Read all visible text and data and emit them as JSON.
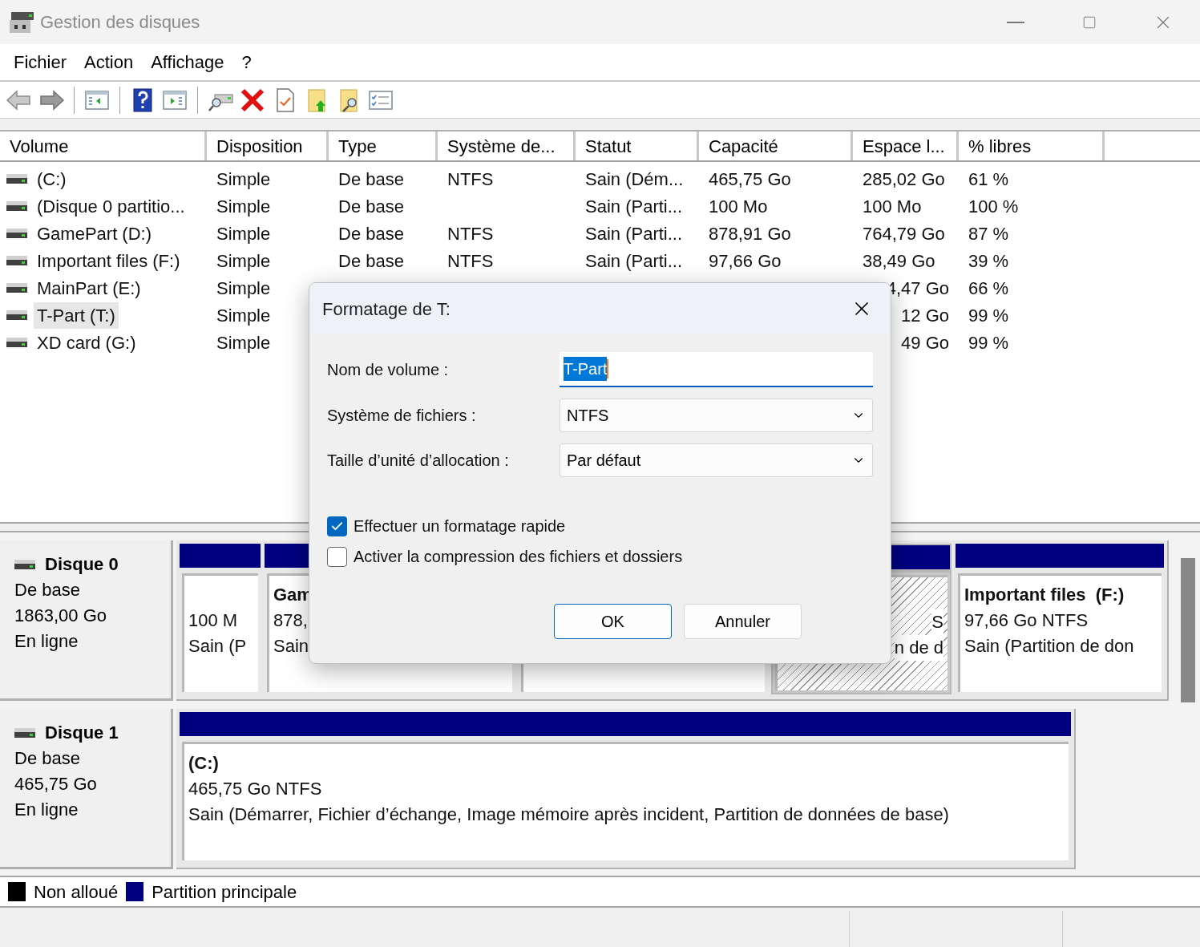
{
  "window": {
    "title": "Gestion des disques"
  },
  "menu": [
    "Fichier",
    "Action",
    "Affichage",
    "?"
  ],
  "table": {
    "columns": [
      "Volume",
      "Disposition",
      "Type",
      "Système de...",
      "Statut",
      "Capacité",
      "Espace l...",
      "% libres"
    ],
    "rows": [
      {
        "selected": false,
        "cells": [
          "(C:)",
          "Simple",
          "De base",
          "NTFS",
          "Sain (Dém...",
          "465,75 Go",
          "285,02 Go",
          "61 %"
        ]
      },
      {
        "selected": false,
        "cells": [
          "(Disque 0 partitio...",
          "Simple",
          "De base",
          null,
          "Sain (Parti...",
          "100 Mo",
          "100 Mo",
          "100 %"
        ]
      },
      {
        "selected": false,
        "cells": [
          "GamePart (D:)",
          "Simple",
          "De base",
          "NTFS",
          "Sain (Parti...",
          "878,91 Go",
          "764,79 Go",
          "87 %"
        ]
      },
      {
        "selected": false,
        "cells": [
          "Important files (F:)",
          "Simple",
          "De base",
          "NTFS",
          "Sain (Parti...",
          "97,66 Go",
          "38,49 Go",
          "39 %"
        ]
      },
      {
        "selected": false,
        "cells": [
          "MainPart (E:)",
          "Simple",
          null,
          null,
          null,
          null,
          "4,47 Go",
          "66 %"
        ]
      },
      {
        "selected": true,
        "cells": [
          "T-Part (T:)",
          "Simple",
          null,
          null,
          null,
          null,
          "12 Go",
          "99 %"
        ]
      },
      {
        "selected": false,
        "cells": [
          "XD card (G:)",
          "Simple",
          null,
          null,
          null,
          null,
          "49 Go",
          "99 %"
        ]
      }
    ]
  },
  "disks": [
    {
      "name": "Disque 0",
      "lines": [
        "De base",
        "1863,00 Go",
        "En ligne"
      ],
      "partitions": [
        {
          "selected": false,
          "covered": false,
          "lines": [
            "100 M",
            "Sain (P"
          ]
        },
        {
          "selected": false,
          "covered": false,
          "title": "Gam",
          "lines": [
            "878,",
            "Sain"
          ]
        },
        {
          "selected": false
        },
        {
          "selected": true,
          "covered": true,
          "lines": [
            "S",
            "n de d"
          ]
        },
        {
          "selected": false,
          "covered": false,
          "title": "Important files  (F:)",
          "lines": [
            "97,66 Go NTFS",
            "Sain (Partition de don"
          ]
        }
      ]
    },
    {
      "name": "Disque 1",
      "lines": [
        "De base",
        "465,75 Go",
        "En ligne"
      ],
      "partitions": [
        {
          "selected": false,
          "covered": false,
          "title": "(C:)",
          "lines": [
            "465,75 Go NTFS",
            "Sain (Démarrer, Fichier d’échange, Image mémoire après incident, Partition de données de base)"
          ]
        }
      ]
    }
  ],
  "legend": [
    {
      "label": "Non alloué",
      "color": "#000000"
    },
    {
      "label": "Partition principale",
      "color": "#000080"
    }
  ],
  "dialog": {
    "title": "Formatage de T:",
    "fields": [
      {
        "kind": "text",
        "label": "Nom de volume :",
        "value": "T-Part",
        "selected": true
      },
      {
        "kind": "select",
        "label": "Système de fichiers :",
        "value": "NTFS"
      },
      {
        "kind": "select",
        "label": "Taille d’unité d’allocation :",
        "value": "Par défaut"
      }
    ],
    "options": [
      {
        "label": "Effectuer un formatage rapide",
        "checked": true
      },
      {
        "label": "Activer la compression des fichiers et dossiers",
        "checked": false
      }
    ],
    "buttons": [
      {
        "label": "OK",
        "kind": "primary"
      },
      {
        "label": "Annuler",
        "kind": "secondary"
      }
    ]
  }
}
